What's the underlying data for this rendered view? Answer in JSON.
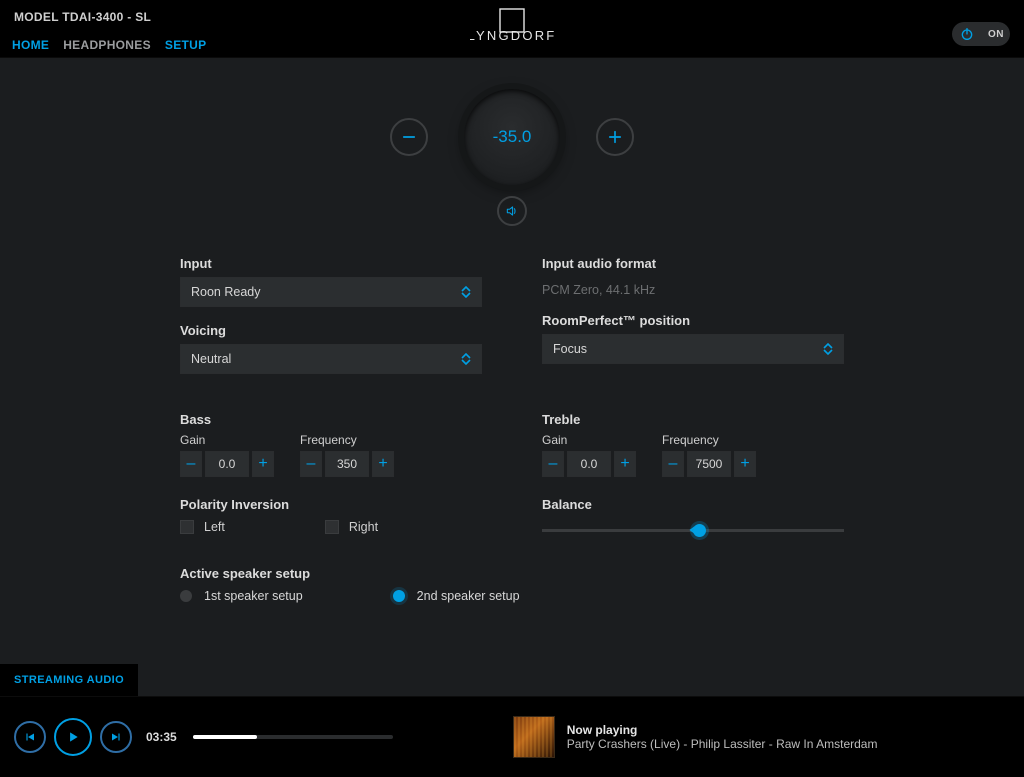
{
  "header": {
    "model": "MODEL TDAI-3400 - SL",
    "tabs": {
      "home": "HOME",
      "headphones": "HEADPHONES",
      "setup": "SETUP"
    },
    "logo_text": "LYNGDORF",
    "power_label": "ON"
  },
  "volume": {
    "value": "-35.0"
  },
  "fields": {
    "input_label": "Input",
    "input_value": "Roon Ready",
    "voicing_label": "Voicing",
    "voicing_value": "Neutral",
    "format_label": "Input audio format",
    "format_value": "PCM Zero, 44.1 kHz",
    "roomperfect_label": "RoomPerfect™ position",
    "roomperfect_value": "Focus"
  },
  "bass": {
    "title": "Bass",
    "gain_label": "Gain",
    "gain_value": "0.0",
    "freq_label": "Frequency",
    "freq_value": "350"
  },
  "treble": {
    "title": "Treble",
    "gain_label": "Gain",
    "gain_value": "0.0",
    "freq_label": "Frequency",
    "freq_value": "7500"
  },
  "polarity": {
    "title": "Polarity Inversion",
    "left": "Left",
    "right": "Right"
  },
  "balance": {
    "title": "Balance",
    "position_pct": 52
  },
  "speaker": {
    "title": "Active speaker setup",
    "opt1": "1st speaker setup",
    "opt2": "2nd speaker setup",
    "selected": 2
  },
  "stream_tab": "STREAMING AUDIO",
  "player": {
    "time": "03:35",
    "progress_pct": 32,
    "now_playing_label": "Now playing",
    "track": "Party Crashers (Live) - Philip Lassiter - Raw In Amsterdam"
  },
  "glyphs": {
    "minus": "–",
    "plus": "+"
  }
}
